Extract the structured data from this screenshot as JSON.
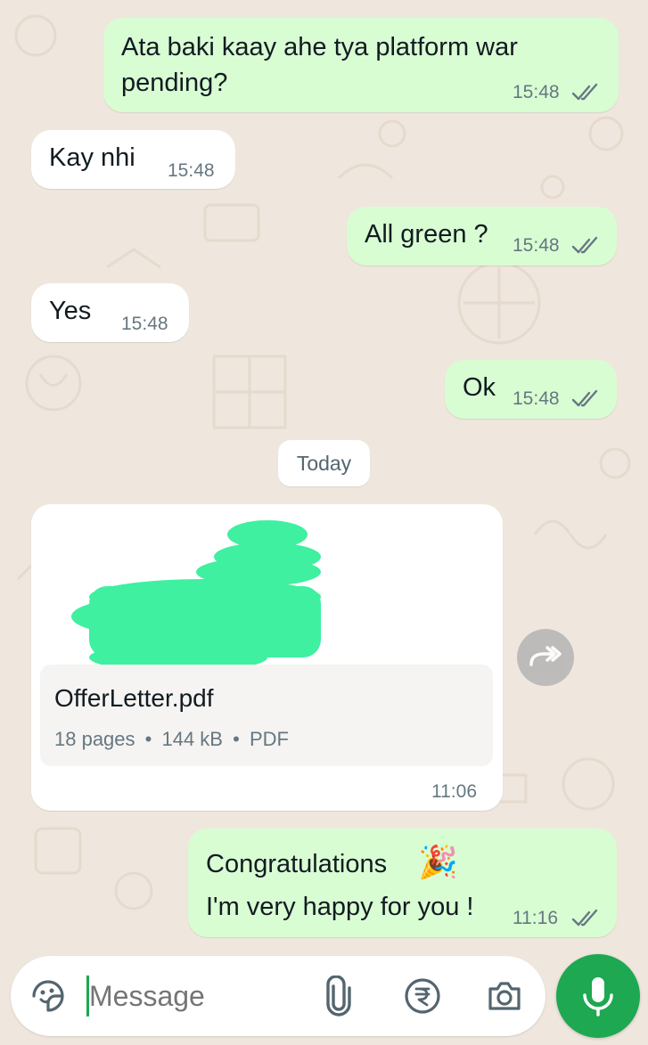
{
  "messages": [
    {
      "text_line1": "Ata baki kaay ahe tya platform war",
      "text_line2": "pending?",
      "time": "15:48",
      "direction": "outgoing",
      "status": "read"
    },
    {
      "text": "Kay nhi",
      "time": "15:48",
      "direction": "incoming"
    },
    {
      "text": "All green ?",
      "time": "15:48",
      "direction": "outgoing",
      "status": "read"
    },
    {
      "text": "Yes",
      "time": "15:48",
      "direction": "incoming"
    },
    {
      "text": "Ok",
      "time": "15:48",
      "direction": "outgoing",
      "status": "read"
    }
  ],
  "date_separator": "Today",
  "document": {
    "file_name": "OfferLetter.pdf",
    "pages": "18 pages",
    "size": "144 kB",
    "type": "PDF",
    "separator": "•",
    "time": "11:06",
    "direction": "incoming"
  },
  "congrats": {
    "line1": "Congratulations",
    "emoji": "🎉",
    "line2": "I'm very happy for you !",
    "time": "11:16",
    "direction": "outgoing",
    "status": "read"
  },
  "input": {
    "placeholder": "Message"
  },
  "colors": {
    "outgoing_bubble": "#d9fdd3",
    "incoming_bubble": "#ffffff",
    "wallpaper": "#efe7dd",
    "mic_button": "#1da851",
    "redaction": "#3ef0a0",
    "read_ticks": "#667781"
  },
  "icons": [
    "sticker-icon",
    "attach-icon",
    "rupee-payment-icon",
    "camera-icon",
    "mic-icon",
    "forward-icon",
    "double-tick-icon"
  ]
}
